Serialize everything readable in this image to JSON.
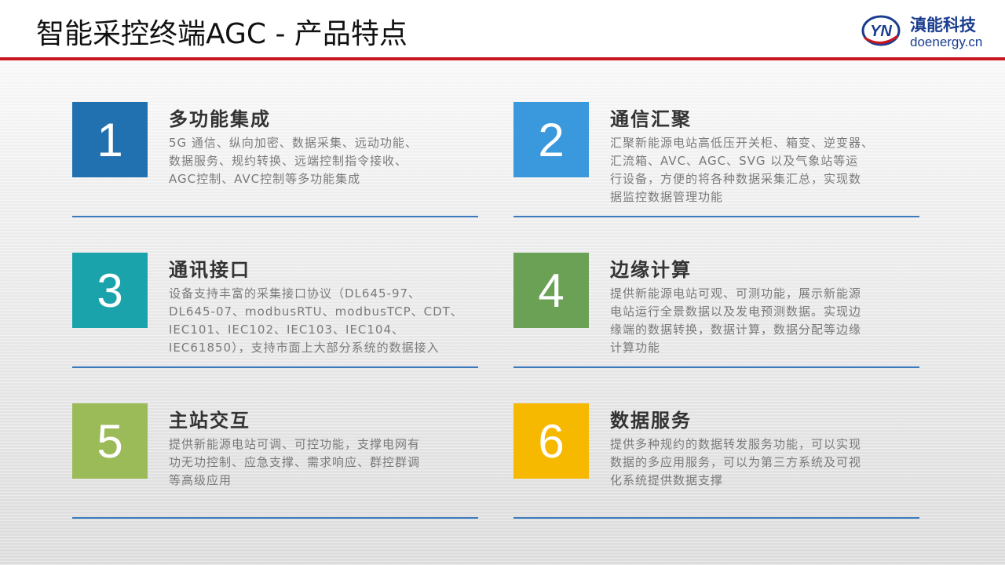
{
  "header": {
    "title": "智能采控终端AGC - 产品特点",
    "brand_cn": "滇能科技",
    "brand_en": "doenergy.cn",
    "logo_text": "YN",
    "accent_red": "#c8161e",
    "brand_blue": "#1a3d8f"
  },
  "features": [
    {
      "num": "1",
      "color": "#2170b0",
      "title": "多功能集成",
      "lines": [
        "5G 通信、纵向加密、数据采集、远动功能、",
        "数据服务、规约转换、远端控制指令接收、",
        "AGC控制、AVC控制等多功能集成"
      ]
    },
    {
      "num": "2",
      "color": "#3a98dc",
      "title": "通信汇聚",
      "lines": [
        "汇聚新能源电站高低压开关柜、箱变、逆变器、",
        "汇流箱、AVC、AGC、SVG 以及气象站等运",
        "行设备，方便的将各种数据采集汇总，实现数",
        "据监控数据管理功能"
      ]
    },
    {
      "num": "3",
      "color": "#1ba3ab",
      "title": "通讯接口",
      "lines": [
        "设备支持丰富的采集接口协议（DL645-97、",
        "DL645-07、modbusRTU、modbusTCP、CDT、",
        "IEC101、IEC102、IEC103、IEC104、",
        "IEC61850），支持市面上大部分系统的数据接入"
      ]
    },
    {
      "num": "4",
      "color": "#6aa155",
      "title": "边缘计算",
      "lines": [
        "提供新能源电站可观、可测功能，展示新能源",
        "电站运行全景数据以及发电预测数据。实现边",
        "缘端的数据转换，数据计算，数据分配等边缘",
        "计算功能"
      ]
    },
    {
      "num": "5",
      "color": "#9bbb59",
      "title": "主站交互",
      "lines": [
        "提供新能源电站可调、可控功能，支撑电网有",
        "功无功控制、应急支撑、需求响应、群控群调",
        "等高级应用"
      ]
    },
    {
      "num": "6",
      "color": "#f7b800",
      "title": "数据服务",
      "lines": [
        "提供多种规约的数据转发服务功能，可以实现",
        "数据的多应用服务，可以为第三方系统及可视",
        "化系统提供数据支撑"
      ]
    }
  ]
}
